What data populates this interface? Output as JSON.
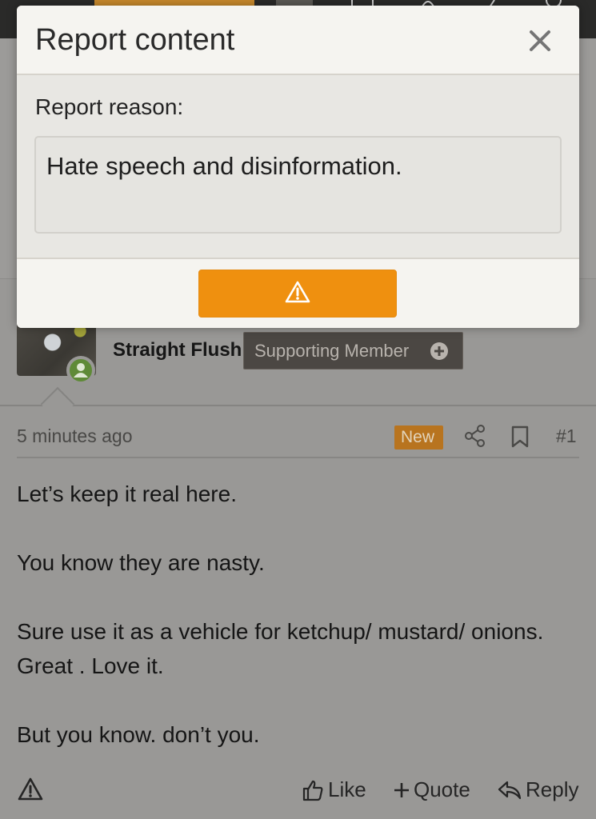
{
  "modal": {
    "title": "Report content",
    "reason_label": "Report reason:",
    "reason_value": "Hate speech and disinformation.",
    "close_icon": "close-icon",
    "submit_icon": "warning-icon"
  },
  "post": {
    "username": "Straight Flush",
    "badge": "Supporting Member",
    "time": "5 minutes ago",
    "new_label": "New",
    "number": "#1",
    "body": [
      "Let’s keep it real here.",
      "You know they are nasty.",
      "Sure use it as a vehicle for ketchup/ mustard/ onions. Great . Love it.",
      "But you know. don’t you."
    ]
  },
  "actions": {
    "like": "Like",
    "quote": "Quote",
    "reply": "Reply"
  },
  "colors": {
    "accent": "#ef900f",
    "new_badge": "#b8741f",
    "online": "#5f8a37"
  }
}
